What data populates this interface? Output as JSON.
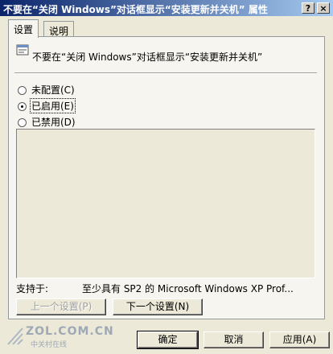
{
  "window": {
    "title": "不要在“关闭 Windows”对话框显示“安装更新并关机” 属性",
    "help_button": "?",
    "close_button": "×"
  },
  "tabs": [
    {
      "label": "设置",
      "active": true
    },
    {
      "label": "说明",
      "active": false
    }
  ],
  "policy": {
    "icon": "policy-setting-icon",
    "name": "不要在“关闭 Windows”对话框显示“安装更新并关机”"
  },
  "options": [
    {
      "label": "未配置(C)",
      "checked": false
    },
    {
      "label": "已启用(E)",
      "checked": true
    },
    {
      "label": "已禁用(D)",
      "checked": false
    }
  ],
  "supported_on": {
    "label": "支持于:",
    "value": "至少具有 SP2 的 Microsoft Windows XP Prof..."
  },
  "nav_buttons": {
    "previous": "上一个设置(P)",
    "next": "下一个设置(N)"
  },
  "dialog_buttons": {
    "ok": "确定",
    "cancel": "取消",
    "apply": "应用(A)"
  },
  "watermark": {
    "main": "ZOL.COM.CN",
    "sub": "中关村在线"
  },
  "colors": {
    "titlebar_start": "#0a246a",
    "titlebar_end": "#a6caf0",
    "dialog_bg": "#ece9d8"
  }
}
